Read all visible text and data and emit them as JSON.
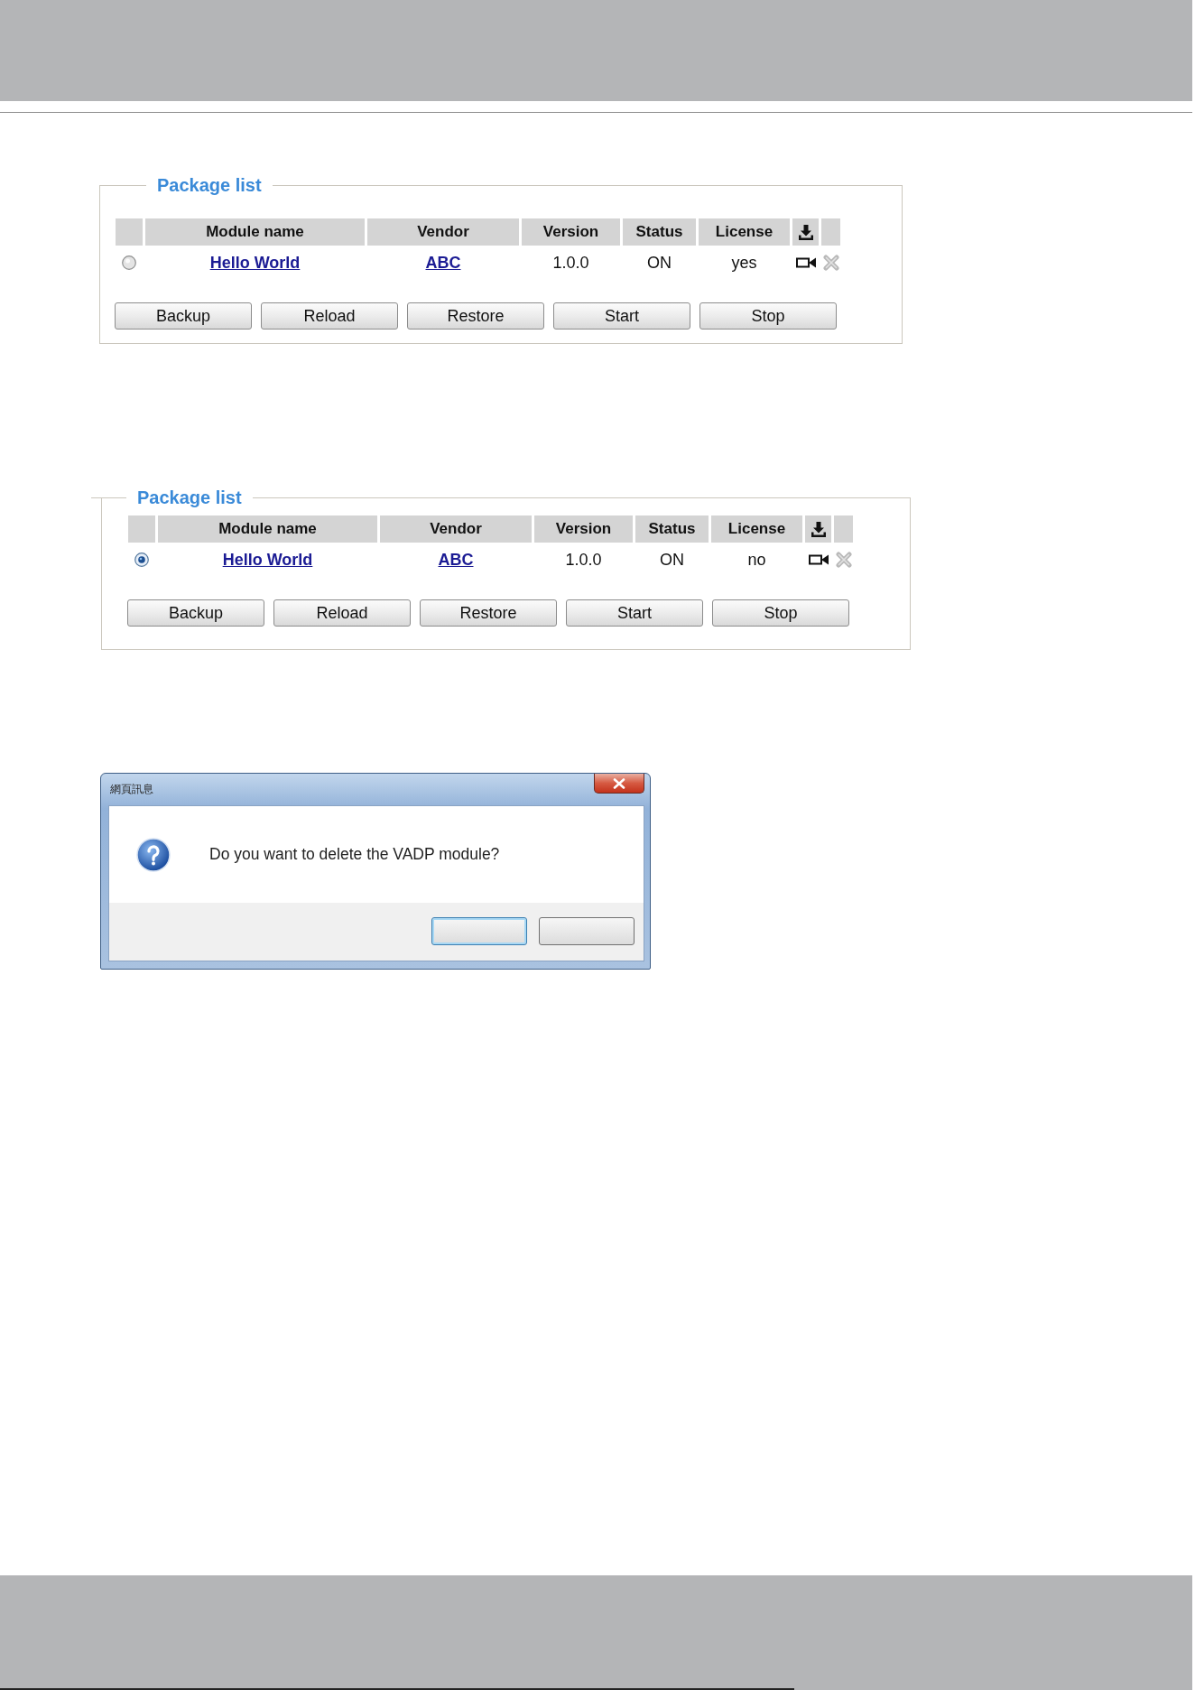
{
  "panels": [
    {
      "legend": "Package list",
      "columns": [
        "Module name",
        "Vendor",
        "Version",
        "Status",
        "License"
      ],
      "rows": [
        {
          "selected": false,
          "module_name": "Hello World",
          "vendor": "ABC",
          "version": "1.0.0",
          "status": "ON",
          "license": "yes"
        }
      ],
      "buttons": [
        "Backup",
        "Reload",
        "Restore",
        "Start",
        "Stop"
      ]
    },
    {
      "legend": "Package list",
      "columns": [
        "Module name",
        "Vendor",
        "Version",
        "Status",
        "License"
      ],
      "rows": [
        {
          "selected": true,
          "module_name": "Hello World",
          "vendor": "ABC",
          "version": "1.0.0",
          "status": "ON",
          "license": "no"
        }
      ],
      "buttons": [
        "Backup",
        "Reload",
        "Restore",
        "Start",
        "Stop"
      ]
    }
  ],
  "dialog": {
    "title": "網頁訊息",
    "message": "Do you want to delete the VADP module?",
    "buttons": [
      {
        "focused": true
      },
      {
        "focused": false
      }
    ]
  }
}
